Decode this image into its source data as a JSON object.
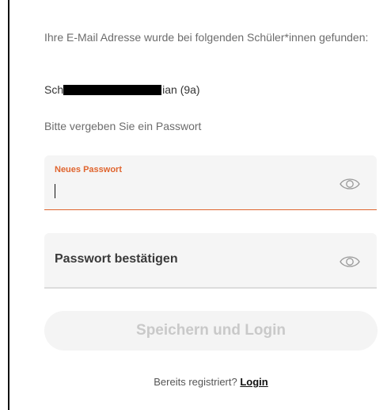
{
  "intro_text": "Ihre E-Mail Adresse wurde bei folgenden Schüler*innen gefunden:",
  "student": {
    "prefix": "Sch",
    "suffix": "ian (9a)"
  },
  "password_hint": "Bitte vergeben Sie ein Passwort",
  "new_password": {
    "label": "Neues Passwort",
    "value": "",
    "eye_icon": "eye-icon"
  },
  "confirm_password": {
    "label": "Passwort bestätigen",
    "eye_icon": "eye-icon"
  },
  "submit_label": "Speichern und Login",
  "footer": {
    "question": "Bereits registriert?",
    "link_label": "Login"
  },
  "colors": {
    "accent": "#e0652f",
    "disabled_text": "#c9c9c9",
    "field_bg": "#f5f5f5"
  }
}
